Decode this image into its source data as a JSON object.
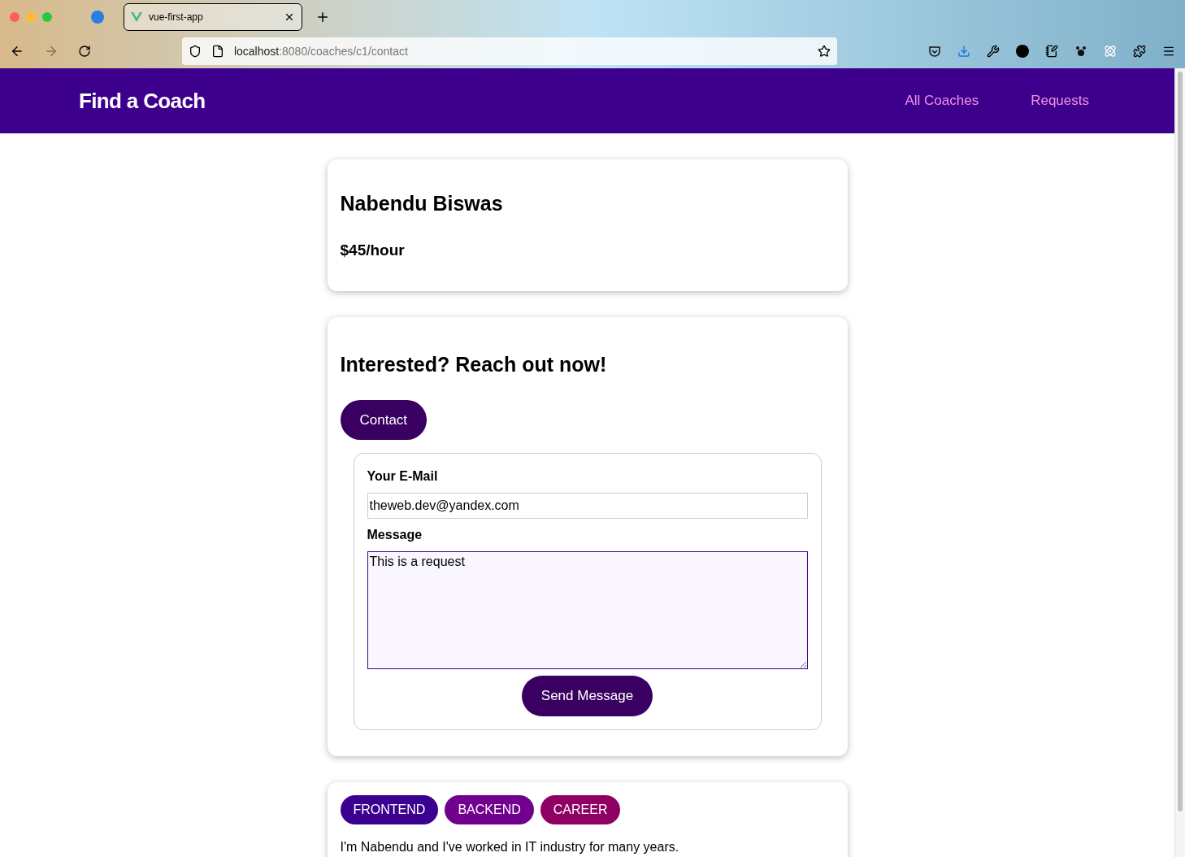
{
  "browser": {
    "tab_title": "vue-first-app",
    "url_host": "localhost",
    "url_path": ":8080/coaches/c1/contact"
  },
  "header": {
    "logo": "Find a Coach",
    "nav": [
      {
        "label": "All Coaches"
      },
      {
        "label": "Requests"
      }
    ]
  },
  "coach": {
    "name": "Nabendu Biswas",
    "rate": "$45/hour"
  },
  "contact": {
    "heading": "Interested? Reach out now!",
    "button": "Contact",
    "fields": [
      {
        "kind": "input",
        "label": "Your E-Mail",
        "value": "theweb.dev@yandex.com",
        "focused": false
      },
      {
        "kind": "textarea",
        "label": "Message",
        "value": "This is a request",
        "focused": true
      }
    ],
    "submit": "Send Message"
  },
  "tags": [
    {
      "label": "FRONTEND",
      "color": "#3a0090"
    },
    {
      "label": "BACKEND",
      "color": "#71008f"
    },
    {
      "label": "CAREER",
      "color": "#8f0064"
    }
  ],
  "description": "I'm Nabendu and I've worked in IT industry for many years."
}
